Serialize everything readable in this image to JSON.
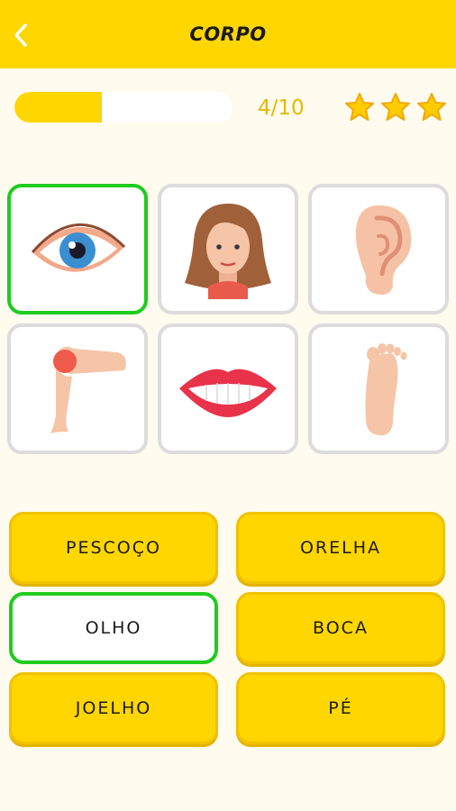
{
  "header": {
    "title": "CORPO",
    "back_icon": "chevron-left-icon"
  },
  "progress": {
    "text": "4/10",
    "fraction": 0.4,
    "stars_earned": 3,
    "stars_total": 3
  },
  "colors": {
    "accent": "#ffd600",
    "correct": "#1fcc1f",
    "background": "#fffbee",
    "card_border": "#dcdcdc"
  },
  "images": [
    {
      "name": "eye",
      "icon": "eye-icon",
      "selected": true
    },
    {
      "name": "face",
      "icon": "face-icon",
      "selected": false
    },
    {
      "name": "ear",
      "icon": "ear-icon",
      "selected": false
    },
    {
      "name": "knee",
      "icon": "knee-leg-icon",
      "selected": false
    },
    {
      "name": "mouth",
      "icon": "mouth-icon",
      "selected": false
    },
    {
      "name": "foot",
      "icon": "foot-icon",
      "selected": false
    }
  ],
  "answers": [
    {
      "label": "PESCOÇO",
      "selected": false
    },
    {
      "label": "ORELHA",
      "selected": false
    },
    {
      "label": "OLHO",
      "selected": true
    },
    {
      "label": "BOCA",
      "selected": false
    },
    {
      "label": "JOELHO",
      "selected": false
    },
    {
      "label": "PÉ",
      "selected": false
    }
  ]
}
